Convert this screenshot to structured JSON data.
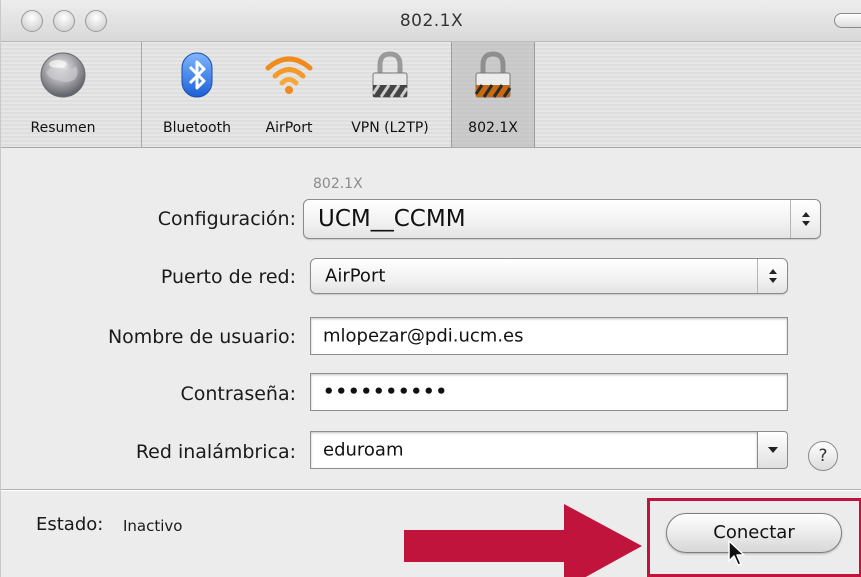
{
  "window": {
    "title": "802.1X"
  },
  "toolbar": {
    "items": [
      {
        "label": "Resumen",
        "icon": "globe-icon"
      },
      {
        "label": "Bluetooth",
        "icon": "bluetooth-icon"
      },
      {
        "label": "AirPort",
        "icon": "airport-wifi-icon"
      },
      {
        "label": "VPN (L2TP)",
        "icon": "lock-icon"
      },
      {
        "label": "802.1X",
        "icon": "lock-icon",
        "selected": true
      }
    ]
  },
  "form": {
    "section_label": "802.1X",
    "configuracion": {
      "label": "Configuración:",
      "value": "UCM__CCMM"
    },
    "puerto": {
      "label": "Puerto de red:",
      "value": "AirPort"
    },
    "usuario": {
      "label": "Nombre de usuario:",
      "value": "mlopezar@pdi.ucm.es"
    },
    "contrasena": {
      "label": "Contraseña:",
      "value": "••••••••••"
    },
    "red": {
      "label": "Red inalámbrica:",
      "value": "eduroam"
    },
    "help_glyph": "?"
  },
  "status": {
    "label": "Estado:",
    "value": "Inactivo"
  },
  "connect_button": {
    "label": "Conectar"
  },
  "colors": {
    "highlight": "#c0143c",
    "arrow": "#c0143c"
  }
}
